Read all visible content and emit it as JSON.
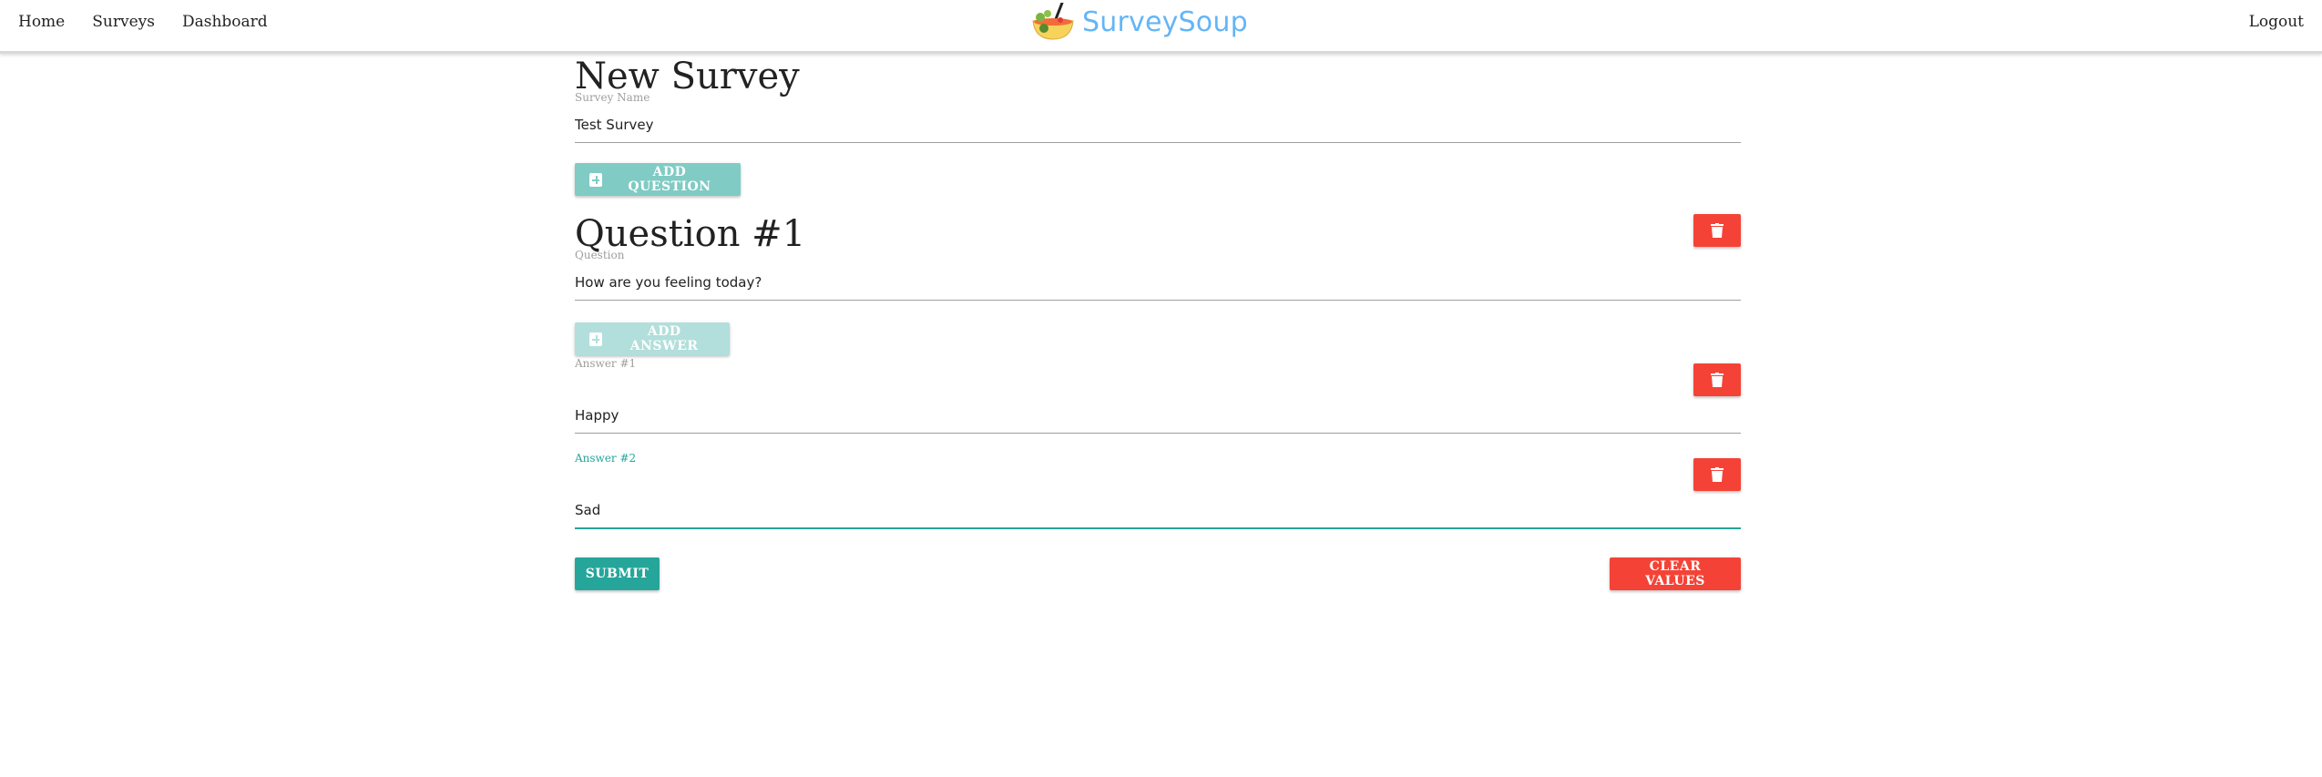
{
  "nav": {
    "links": [
      "Home",
      "Surveys",
      "Dashboard"
    ],
    "brand": "SurveySoup",
    "logout": "Logout"
  },
  "form": {
    "title": "New Survey",
    "survey_name_label": "Survey Name",
    "survey_name_value": "Test Survey",
    "add_question_label": "ADD QUESTION",
    "question": {
      "title": "Question #1",
      "question_label": "Question",
      "question_value": "How are you feeling today?",
      "add_answer_label": "ADD ANSWER",
      "answers": [
        {
          "label": "Answer #1",
          "value": "Happy"
        },
        {
          "label": "Answer #2",
          "value": "Sad"
        }
      ]
    },
    "submit_label": "SUBMIT",
    "clear_label": "CLEAR VALUES"
  },
  "colors": {
    "accent": "#26a69a",
    "danger": "#f44336",
    "brand": "#64b5f6"
  },
  "icons": {
    "add": "plus-square-icon",
    "delete": "trash-icon",
    "logo": "soup-bowl-icon"
  }
}
